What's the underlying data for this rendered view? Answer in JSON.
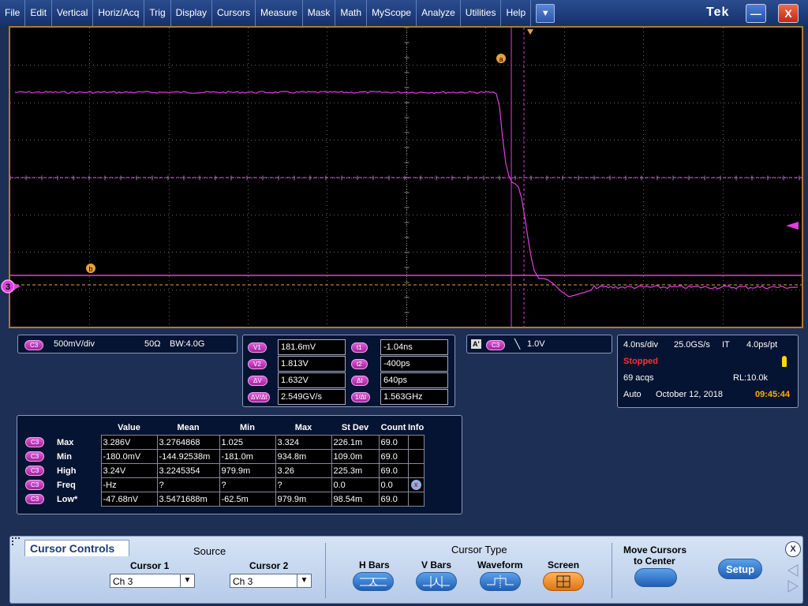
{
  "menubar": {
    "items": [
      "File",
      "Edit",
      "Vertical",
      "Horiz/Acq",
      "Trig",
      "Display",
      "Cursors",
      "Measure",
      "Mask",
      "Math",
      "MyScope",
      "Analyze",
      "Utilities",
      "Help"
    ],
    "dropdown_glyph": "▼",
    "brand": "Tek",
    "min_glyph": "—",
    "close_glyph": "X"
  },
  "graticule": {
    "channel_marker": "3",
    "cursor_a_label": "a",
    "cursor_b_label": "b",
    "trace_color": "#e040e0",
    "cursor_color": "#e8a040"
  },
  "channel": {
    "chip": "C3",
    "scale": "500mV/div",
    "impedance": "50Ω",
    "bw_label": "BW:4.0G"
  },
  "cursor_readout": {
    "v1_label": "V1",
    "v1": "181.6mV",
    "v2_label": "V2",
    "v2": "1.813V",
    "dv_label": "ΔV",
    "dv": "1.632V",
    "dvdt_label": "ΔV/Δt",
    "dvdt": "2.549GV/s",
    "t1_label": "t1",
    "t1": "-1.04ns",
    "t2_label": "t2",
    "t2": "-400ps",
    "dt_label": "Δt",
    "dt": "640ps",
    "inv_dt_label": "1/Δt",
    "inv_dt": "1.563GHz"
  },
  "trigger": {
    "mode_badge": "A'",
    "chip": "C3",
    "slope_glyph": "╲",
    "level": "1.0V"
  },
  "acquisition": {
    "timebase": "4.0ns/div",
    "sample_rate": "25.0GS/s",
    "mode": "IT",
    "resolution": "4.0ps/pt",
    "status": "Stopped",
    "acqs": "69 acqs",
    "record_length": "RL:10.0k",
    "trigger_mode": "Auto",
    "date": "October 12, 2018",
    "time": "09:45:44"
  },
  "measurements": {
    "headers": [
      "Value",
      "Mean",
      "Min",
      "Max",
      "St Dev",
      "Count",
      "Info"
    ],
    "rows": [
      {
        "chip": "C3",
        "name": "Max",
        "value": "3.286V",
        "mean": "3.2764868",
        "min": "1.025",
        "max": "3.324",
        "stdev": "226.1m",
        "count": "69.0",
        "info": ""
      },
      {
        "chip": "C3",
        "name": "Min",
        "value": "-180.0mV",
        "mean": "-144.92538m",
        "min": "-181.0m",
        "max": "934.8m",
        "stdev": "109.0m",
        "count": "69.0",
        "info": ""
      },
      {
        "chip": "C3",
        "name": "High",
        "value": "3.24V",
        "mean": "3.2245354",
        "min": "979.9m",
        "max": "3.26",
        "stdev": "225.3m",
        "count": "69.0",
        "info": ""
      },
      {
        "chip": "C3",
        "name": "Freq",
        "value": "-Hz",
        "mean": "?",
        "min": "?",
        "max": "?",
        "stdev": "0.0",
        "count": "0.0",
        "info": "x"
      },
      {
        "chip": "C3",
        "name": "Low*",
        "value": "-47.68nV",
        "mean": "3.5471688m",
        "min": "-62.5m",
        "max": "979.9m",
        "stdev": "98.54m",
        "count": "69.0",
        "info": ""
      }
    ]
  },
  "cursor_controls": {
    "title": "Cursor Controls",
    "source_label": "Source",
    "cursor1_label": "Cursor 1",
    "cursor1_value": "Ch 3",
    "cursor2_label": "Cursor 2",
    "cursor2_value": "Ch 3",
    "cursor_type_label": "Cursor Type",
    "types": [
      "H Bars",
      "V Bars",
      "Waveform",
      "Screen"
    ],
    "selected_type": "Screen",
    "move_label_1": "Move Cursors",
    "move_label_2": "to Center",
    "setup_label": "Setup",
    "close_glyph": "X"
  }
}
